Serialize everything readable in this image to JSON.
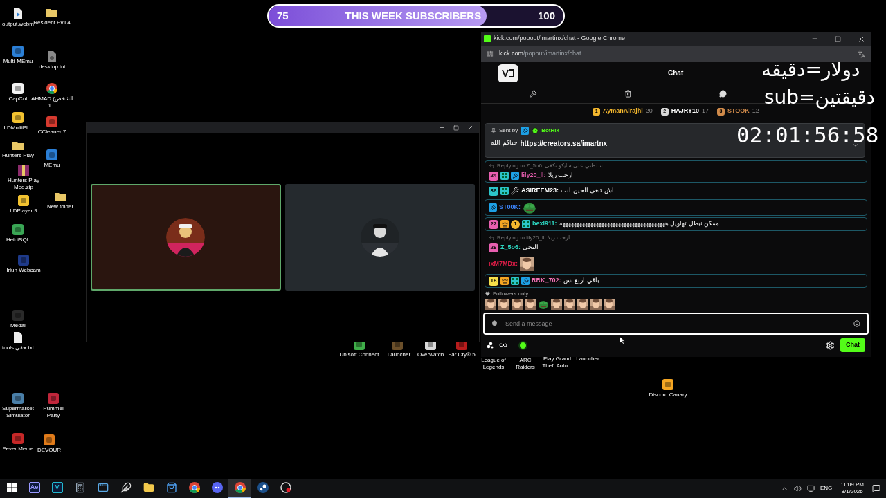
{
  "subscriber_goal": {
    "current": "75",
    "label": "THIS WEEK SUBSCRIBERS",
    "target": "100",
    "level": 0.74
  },
  "desktop_icons": [
    {
      "label": "output.webm",
      "kind": "video"
    },
    {
      "label": "Resident Evil 4",
      "kind": "folder"
    },
    {
      "label": "Multi-MEmu",
      "kind": "app",
      "color": "#2b7fd6"
    },
    {
      "label": "desktop.ini",
      "kind": "settings-file"
    },
    {
      "label": "CapCut",
      "kind": "app",
      "color": "#f2f2f2"
    },
    {
      "label": "AHMAD (الشخص 1...",
      "kind": "chrome"
    },
    {
      "label": "LDMultiPl...",
      "kind": "app",
      "color": "#f2c230"
    },
    {
      "label": "CCleaner 7",
      "kind": "app",
      "color": "#d63a2f"
    },
    {
      "label": "Hunters Play",
      "kind": "folder"
    },
    {
      "label": "MEmu",
      "kind": "app",
      "color": "#2b7fd6"
    },
    {
      "label": "Hunters Play Mod.zip",
      "kind": "archive"
    },
    {
      "label": "LDPlayer 9",
      "kind": "app",
      "color": "#f2c230"
    },
    {
      "label": "New folder",
      "kind": "folder"
    },
    {
      "label": "HeidiSQL",
      "kind": "app",
      "color": "#3aa655"
    },
    {
      "label": "Iriun Webcam",
      "kind": "app",
      "color": "#1e3a8a"
    },
    {
      "label": "Medal",
      "kind": "app",
      "color": "#2a2a2a"
    },
    {
      "label": "tools حقي.txt",
      "kind": "file"
    },
    {
      "label": "Supermarket Simulator",
      "kind": "app",
      "color": "#4a7fa8"
    },
    {
      "label": "Pummel Party",
      "kind": "app",
      "color": "#c0263b"
    },
    {
      "label": "Fever Meme",
      "kind": "app",
      "color": "#c62828"
    },
    {
      "label": "DEVOUR",
      "kind": "app",
      "color": "#e07b1a"
    },
    {
      "label": "Ubisoft Connect",
      "kind": "app",
      "color": "#3fae49"
    },
    {
      "label": "TLauncher",
      "kind": "app",
      "color": "#6b4f2a"
    },
    {
      "label": "Overwatch",
      "kind": "app",
      "color": "#d9d9d9"
    },
    {
      "label": "Far Cry® 5",
      "kind": "app",
      "color": "#b71c1c"
    },
    {
      "label": "League of Legends",
      "kind": "hidden"
    },
    {
      "label": "ARC Raiders",
      "kind": "hidden"
    },
    {
      "label": "Play Grand Theft Auto...",
      "kind": "hidden"
    },
    {
      "label": "Launcher",
      "kind": "hidden"
    },
    {
      "label": "Discord Canary",
      "kind": "app",
      "color": "#f5a623"
    }
  ],
  "call_window": {
    "tiles": [
      {
        "speaking": true
      },
      {
        "speaking": false
      }
    ]
  },
  "browser": {
    "title": "kick.com/popout/imartinx/chat - Google Chrome",
    "url_host": "kick.com",
    "url_path": "/popout/imartinx/chat",
    "chat": {
      "header": "Chat",
      "leaderboard": [
        {
          "rank": "1",
          "name": "AymanAlrajhi",
          "count": "20",
          "color": "#f5b82e"
        },
        {
          "rank": "2",
          "name": "HAJRY10",
          "count": "17",
          "color": "#d9d9d9"
        },
        {
          "rank": "3",
          "name": "STOOK",
          "count": "12",
          "color": "#d08a4a"
        }
      ],
      "pinned": {
        "sent_by": "Sent by",
        "sender": "BotRix",
        "text": "حياكم الله",
        "link": "https://creators.sa/imartnx"
      },
      "messages": [
        {
          "reply": "Replying to Z_5o6: سلطني على سايكو تكفى",
          "badges": [
            {
              "kind": "sub",
              "label": "24",
              "color": "#e85fb0"
            },
            {
              "kind": "og"
            },
            {
              "kind": "mod"
            }
          ],
          "user": "lily20_ll:",
          "color": "#e85fb0",
          "text": "ارحب زيلا",
          "highlighted": true
        },
        {
          "badges": [
            {
              "kind": "sub",
              "label": "36",
              "color": "#2cc5c9"
            },
            {
              "kind": "og"
            },
            {
              "kind": "wrench"
            }
          ],
          "user": "ASIREEM23:",
          "color": "#ffffff",
          "text": "اش تبغى الحين انت",
          "highlighted": false
        },
        {
          "badges": [
            {
              "kind": "mod"
            }
          ],
          "user": "ST00K:",
          "color": "#3b82f6",
          "emote": {
            "kind": "pepe"
          },
          "highlighted": true
        },
        {
          "badges": [
            {
              "kind": "sub",
              "label": "22",
              "color": "#e85fb0"
            },
            {
              "kind": "crown"
            },
            {
              "kind": "gift",
              "label": "1"
            },
            {
              "kind": "og"
            }
          ],
          "user": "bexl911:",
          "color": "#2dd4bf",
          "text": "ممكن نبطل تهاويل ههههههههههههههههههههههههههههههههههههههه",
          "highlighted": true
        },
        {
          "reply": "Replying to lily20_ll: ارحب زيلا",
          "badges": [
            {
              "kind": "sub",
              "label": "28",
              "color": "#e85fb0"
            }
          ],
          "user": "Z_5o6:",
          "color": "#2dd4bf",
          "text": "النجى",
          "highlighted": false
        },
        {
          "user": "ixM7MDx:",
          "color": "#e11d48",
          "emote": {
            "kind": "picture"
          },
          "highlighted": false
        },
        {
          "badges": [
            {
              "kind": "sub",
              "label": "18",
              "color": "#f5e04a"
            },
            {
              "kind": "crown"
            },
            {
              "kind": "og"
            },
            {
              "kind": "mod"
            }
          ],
          "user": "RRK_702:",
          "color": "#f472b6",
          "text": "باقي اربع بس",
          "highlighted": true
        }
      ],
      "followers_only": "Followers only",
      "emotes": [
        {
          "kind": "picture"
        },
        {
          "kind": "picture"
        },
        {
          "kind": "picture"
        },
        {
          "kind": "picture"
        },
        {
          "kind": "pepe"
        },
        {
          "kind": "picture"
        },
        {
          "kind": "picture"
        },
        {
          "kind": "picture"
        },
        {
          "kind": "picture"
        },
        {
          "kind": "picture"
        }
      ],
      "input": {
        "placeholder": "Send a message"
      },
      "send_button": "Chat"
    }
  },
  "overlay": {
    "line_1": "دولار=دقيقه",
    "line_2": "sub=دقيقتين",
    "timer": "02:01:56:58"
  },
  "taskbar": {
    "apps": [
      {
        "kind": "start",
        "active": false
      },
      {
        "kind": "text-app",
        "label": "Ae",
        "color": "#9999ff",
        "active": false
      },
      {
        "kind": "text-app",
        "label": "V",
        "color": "#22b8cf",
        "active": false
      },
      {
        "kind": "calculator",
        "active": false
      },
      {
        "kind": "window",
        "active": false
      },
      {
        "kind": "feather",
        "active": false
      },
      {
        "kind": "folder",
        "active": false
      },
      {
        "kind": "store",
        "active": false
      },
      {
        "kind": "chrome",
        "active": false
      },
      {
        "kind": "discord",
        "active": false
      },
      {
        "kind": "chrome",
        "active": true
      },
      {
        "kind": "steam",
        "active": false
      },
      {
        "kind": "record",
        "active": false
      }
    ],
    "language": "ENG",
    "time": "11:09 PM",
    "date": "8/1/2026"
  }
}
